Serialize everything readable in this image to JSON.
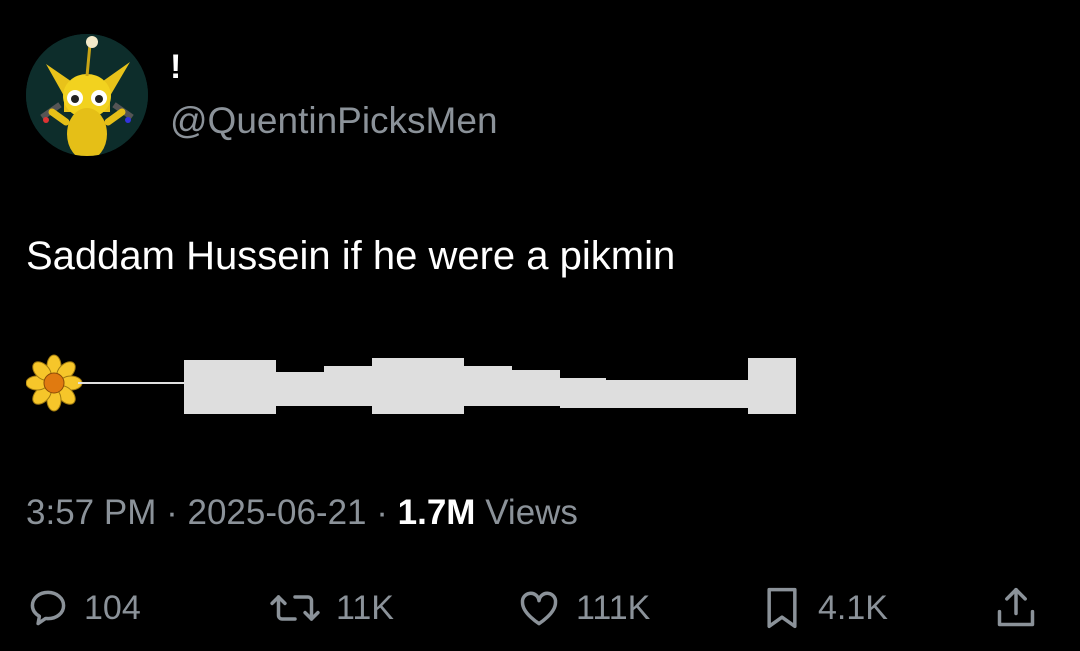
{
  "author": {
    "display_name": "!",
    "handle": "@QuentinPicksMen"
  },
  "tweet": {
    "text": "Saddam Hussein if he were a pikmin",
    "time": "3:57 PM",
    "date": "2025-06-21",
    "views_count": "1.7M",
    "views_label": "Views",
    "separator": "·"
  },
  "actions": {
    "replies": "104",
    "retweets": "11K",
    "likes": "111K",
    "bookmarks": "4.1K"
  },
  "icons": {
    "flower": "daisy-flower-icon",
    "reply": "speech-bubble-icon",
    "retweet": "retweet-arrows-icon",
    "like": "heart-icon",
    "bookmark": "bookmark-icon",
    "share": "share-upload-icon"
  },
  "colors": {
    "background": "#000000",
    "muted_text": "#8b9299",
    "primary_text": "#ffffff"
  }
}
